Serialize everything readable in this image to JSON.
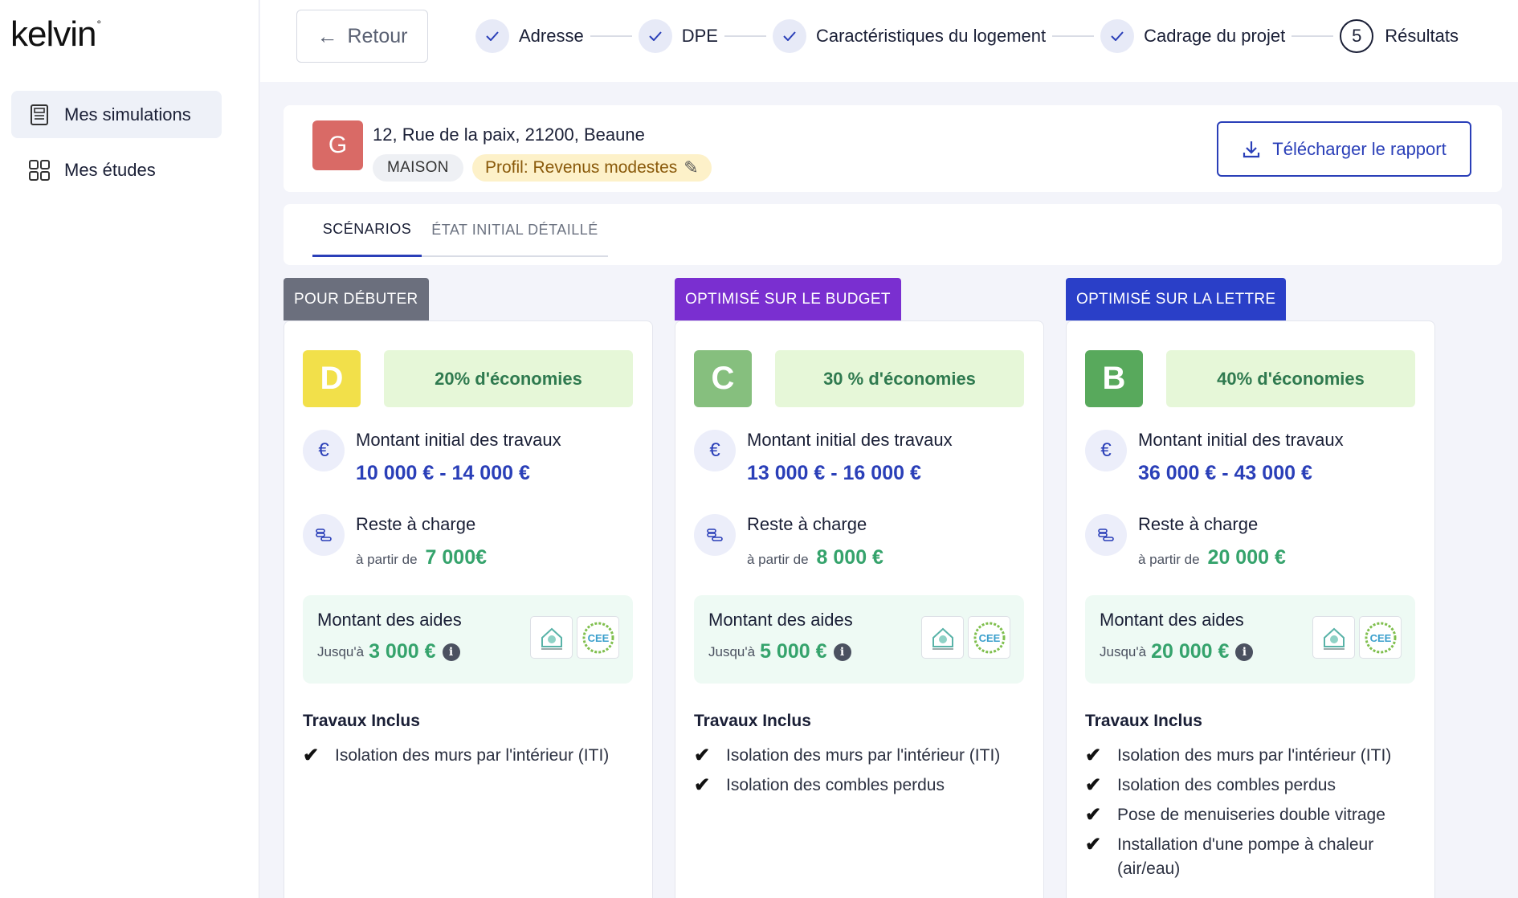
{
  "app": {
    "logo": "kelvin",
    "logo_mark": "°"
  },
  "sidebar": {
    "items": [
      {
        "label": "Mes simulations",
        "icon": "document-icon",
        "active": true
      },
      {
        "label": "Mes études",
        "icon": "grid-icon",
        "active": false
      }
    ]
  },
  "topbar": {
    "back_label": "Retour",
    "steps": [
      {
        "label": "Adresse",
        "state": "done"
      },
      {
        "label": "DPE",
        "state": "done"
      },
      {
        "label": "Caractéristiques du logement",
        "state": "done"
      },
      {
        "label": "Cadrage du projet",
        "state": "done"
      },
      {
        "label": "Résultats",
        "state": "current",
        "number": "5"
      }
    ]
  },
  "property": {
    "badge": "G",
    "address": "12, Rue de la paix, 21200, Beaune",
    "type": "MAISON",
    "profile": "Profil: Revenus modestes",
    "download_label": "Télécharger le rapport"
  },
  "tabs": [
    {
      "label": "SCÉNARIOS",
      "active": true
    },
    {
      "label": "ÉTAT INITIAL DÉTAILLÉ",
      "active": false
    }
  ],
  "labels": {
    "initial_cost": "Montant initial des travaux",
    "remaining": "Reste à charge",
    "from": "à partir de",
    "aids": "Montant des aides",
    "up_to": "Jusqu'à",
    "works_included": "Travaux Inclus"
  },
  "scenarios": [
    {
      "tag": "POUR DÉBUTER",
      "tag_color": "#6b6f7d",
      "grade": "D",
      "grade_color": "#f2e04a",
      "savings": "20% d'économies",
      "initial_cost": "10 000 € - 14 000 €",
      "remaining": "7 000€",
      "aids": "3 000 €",
      "works": [
        "Isolation des murs par l'intérieur (ITI)"
      ]
    },
    {
      "tag": "OPTIMISÉ SUR LE BUDGET",
      "tag_color": "#7a2fd0",
      "grade": "C",
      "grade_color": "#86bf7e",
      "savings": "30 % d'économies",
      "initial_cost": "13 000 € - 16 000 €",
      "remaining": "8 000 €",
      "aids": "5 000 €",
      "works": [
        "Isolation des murs par l'intérieur (ITI)",
        "Isolation des combles perdus"
      ]
    },
    {
      "tag": "OPTIMISÉ SUR LA LETTRE",
      "tag_color": "#2a3fc8",
      "grade": "B",
      "grade_color": "#58a95c",
      "savings": "40% d'économies",
      "initial_cost": "36 000 € - 43 000 €",
      "remaining": "20 000 €",
      "aids": "20 000 €",
      "works": [
        "Isolation des murs par l'intérieur (ITI)",
        "Isolation des combles perdus",
        "Pose de menuiseries double vitrage",
        "Installation d'une pompe à chaleur (air/eau)"
      ]
    }
  ],
  "aid_logos": [
    "maprimerenov-logo",
    "cee-logo"
  ]
}
